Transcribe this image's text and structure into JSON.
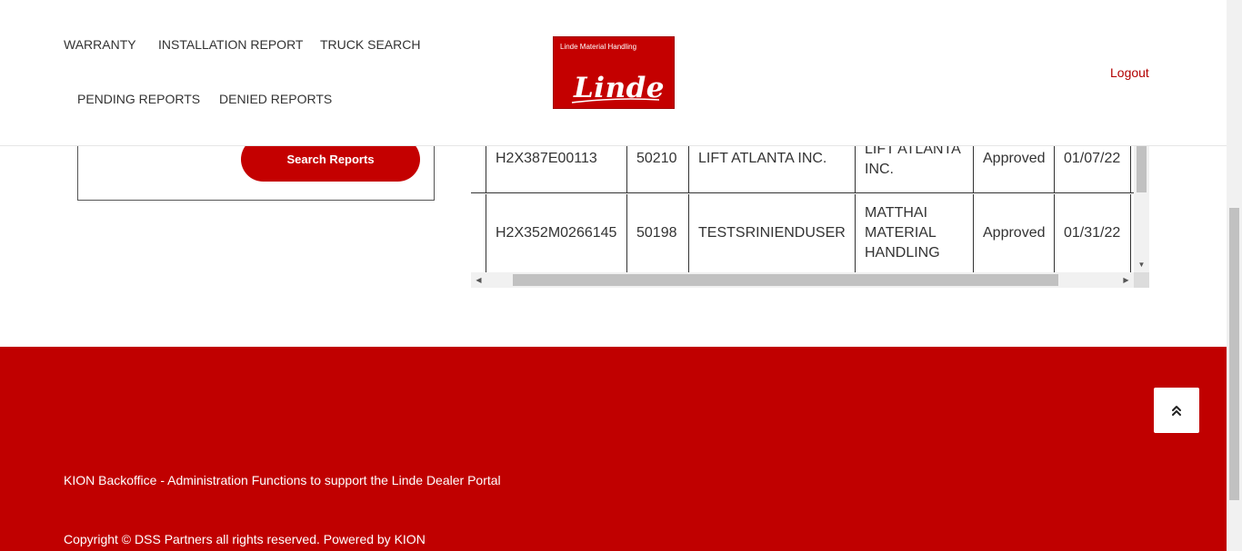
{
  "nav": {
    "warranty": "WARRANTY",
    "installation_report": "INSTALLATION REPORT",
    "truck_search": "TRUCK SEARCH",
    "pending_reports": "PENDING REPORTS",
    "denied_reports": "DENIED REPORTS",
    "logout": "Logout"
  },
  "logo": {
    "subtitle": "Linde Material Handling",
    "wordmark": "Linde"
  },
  "search": {
    "button_label": "Search Reports"
  },
  "table": {
    "rows": [
      {
        "serial": "H2X387E00113",
        "number": "50210",
        "dealer": "LIFT ATLANTA INC.",
        "customer": "LIFT ATLANTA INC.",
        "status": "Approved",
        "date": "01/07/22"
      },
      {
        "serial": "H2X352M0266145",
        "number": "50198",
        "dealer": "TESTSRINIENDUSER",
        "customer": "MATTHAI MATERIAL HANDLING",
        "status": "Approved",
        "date": "01/31/22"
      }
    ]
  },
  "footer": {
    "description": "KION Backoffice - Administration Functions to support the Linde Dealer Portal",
    "copyright": "Copyright © DSS Partners all rights reserved. Powered by KION"
  },
  "icons": {
    "scroll_top": "double-chevron-up-icon"
  },
  "colors": {
    "brand_red": "#c40000",
    "footer_red": "#c00000"
  }
}
